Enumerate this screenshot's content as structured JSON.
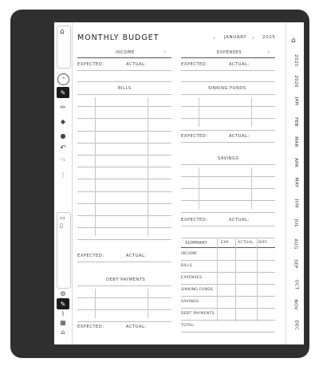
{
  "page": {
    "title": "MONTHLY BUDGET",
    "month": "JANUARY",
    "year": "2025"
  },
  "left": {
    "income_label": "INCOME",
    "expected": "EXPECTED:",
    "actual": "ACTUAL:",
    "bills_label": "BILLS",
    "debt_label": "DEBT PAYMENTS"
  },
  "right": {
    "expenses_label": "EXPENSES",
    "sinking_label": "SINKING FUNDS",
    "savings_label": "SAVINGS"
  },
  "summary": {
    "title": "SUMMARY",
    "cols": [
      "EXP.",
      "ACTUAL",
      "DIFF."
    ],
    "rows": [
      "INCOME",
      "BILLS",
      "EXPENSES",
      "SINKING FUNDS",
      "SAVINGS",
      "DEBT PAYMENTS",
      "TOTAL:"
    ]
  },
  "tabs": [
    "2025",
    "2026",
    "JAN",
    "FEB",
    "MAR",
    "APR",
    "MAY",
    "JUN",
    "JUL",
    "AUG",
    "SEP",
    "OCT",
    "NOV",
    "DEC"
  ],
  "icons": {
    "home": "home-icon",
    "toolbar": [
      "pen-icon",
      "highlighter-icon",
      "eraser-icon",
      "lasso-icon",
      "undo-icon",
      "redo-icon",
      "more-icon"
    ],
    "bottom": [
      "notebook-icon",
      "page-icon",
      "settings-icon",
      "pen-icon",
      "ruler-icon",
      "grid-icon",
      "tag-icon"
    ]
  }
}
